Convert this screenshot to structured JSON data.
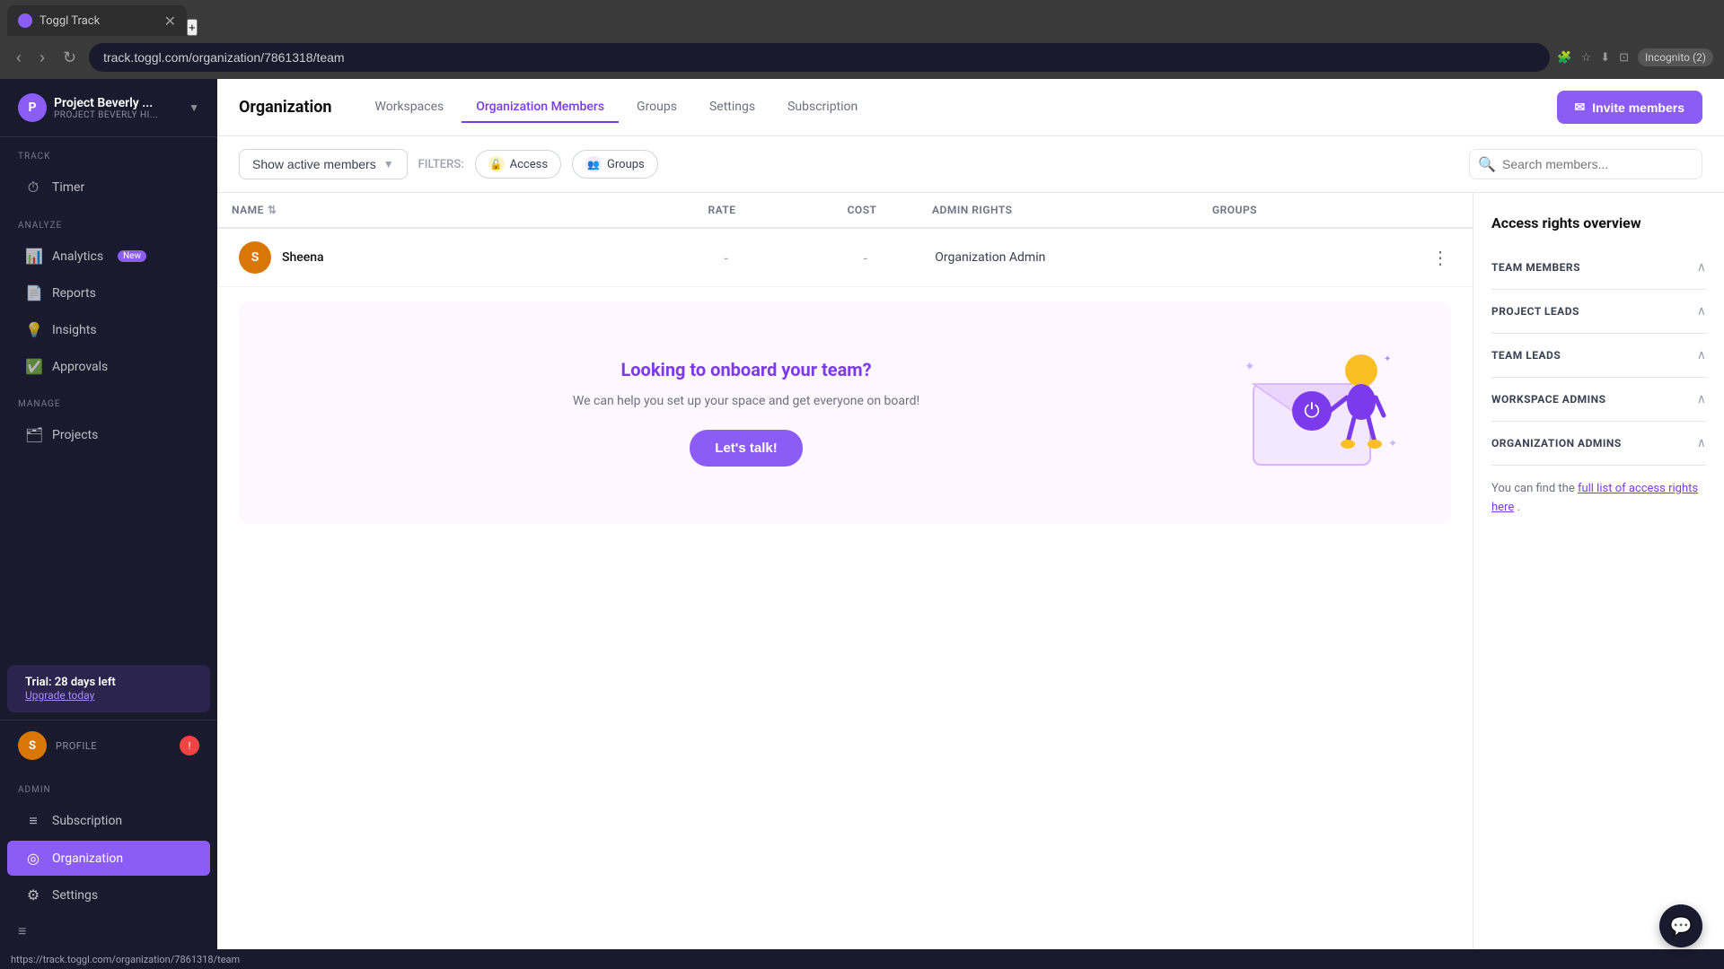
{
  "browser": {
    "tab_title": "Toggl Track",
    "tab_favicon": "T",
    "address": "track.toggl.com/organization/7861318/team",
    "incognito_label": "Incognito (2)"
  },
  "sidebar": {
    "project_name": "Project Beverly ...",
    "project_sub": "PROJECT BEVERLY HI...",
    "project_icon": "P",
    "track_label": "TRACK",
    "timer_label": "Timer",
    "analyze_label": "ANALYZE",
    "analytics_label": "Analytics",
    "analytics_badge": "New",
    "reports_label": "Reports",
    "insights_label": "Insights",
    "approvals_label": "Approvals",
    "manage_label": "MANAGE",
    "projects_label": "Projects",
    "trial_title": "Trial: 28 days left",
    "trial_upgrade": "Upgrade today",
    "admin_label": "ADMIN",
    "subscription_label": "Subscription",
    "organization_label": "Organization",
    "settings_label": "Settings",
    "profile_label": "PROFILE",
    "toggle_icon": "≡"
  },
  "top_nav": {
    "title": "Organization",
    "tabs": [
      {
        "label": "Workspaces",
        "active": false
      },
      {
        "label": "Organization Members",
        "active": true
      },
      {
        "label": "Groups",
        "active": false
      },
      {
        "label": "Settings",
        "active": false
      },
      {
        "label": "Subscription",
        "active": false
      }
    ],
    "invite_btn": "Invite members"
  },
  "filters": {
    "show_members": "Show active members",
    "filters_label": "FILTERS:",
    "access_filter": "Access",
    "groups_filter": "Groups",
    "search_placeholder": "Search members..."
  },
  "table": {
    "columns": {
      "name": "NAME",
      "rate": "RATE",
      "cost": "COST",
      "admin_rights": "ADMIN RIGHTS",
      "groups": "GROUPS"
    },
    "rows": [
      {
        "name": "Sheena",
        "avatar_initials": "S",
        "rate": "-",
        "cost": "-",
        "admin_rights": "Organization Admin",
        "groups": ""
      }
    ]
  },
  "onboarding": {
    "title": "Looking to onboard your team?",
    "description": "We can help you set up your space and get everyone on board!",
    "cta_label": "Let's talk!"
  },
  "right_panel": {
    "title": "Access rights overview",
    "sections": [
      {
        "label": "TEAM MEMBERS"
      },
      {
        "label": "PROJECT LEADS"
      },
      {
        "label": "TEAM LEADS"
      },
      {
        "label": "WORKSPACE ADMINS"
      },
      {
        "label": "ORGANIZATION ADMINS"
      }
    ],
    "footer_text": "You can find the ",
    "footer_link": "full list of access rights here",
    "footer_period": "."
  },
  "status_bar": {
    "url": "https://track.toggl.com/organization/7861318/team"
  }
}
